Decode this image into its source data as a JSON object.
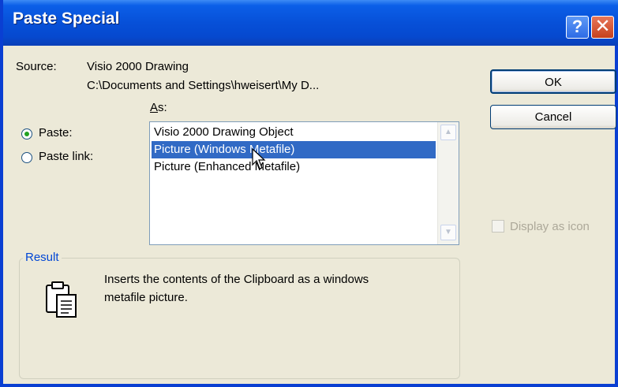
{
  "window": {
    "title": "Paste Special"
  },
  "title_buttons": {
    "help": "?",
    "close": "✕"
  },
  "source": {
    "label": "Source:",
    "name": "Visio 2000 Drawing",
    "path": "C:\\Documents and Settings\\hweisert\\My D..."
  },
  "as_label": "As:",
  "options": {
    "paste": "Paste:",
    "paste_link": "Paste link:",
    "selected": "paste"
  },
  "list": {
    "items": [
      "Visio 2000 Drawing Object",
      "Picture (Windows Metafile)",
      "Picture (Enhanced Metafile)"
    ],
    "selected_index": 1
  },
  "buttons": {
    "ok": "OK",
    "cancel": "Cancel"
  },
  "display_as_icon": {
    "label": "Display as icon",
    "checked": false,
    "enabled": false
  },
  "result": {
    "title": "Result",
    "line1": "Inserts the contents of the Clipboard as a windows",
    "line2": "metafile picture."
  },
  "colors": {
    "title_bar": "#0750d8",
    "selection": "#316ac5",
    "dialog_bg": "#ece9d8",
    "group_title": "#0046d5"
  }
}
